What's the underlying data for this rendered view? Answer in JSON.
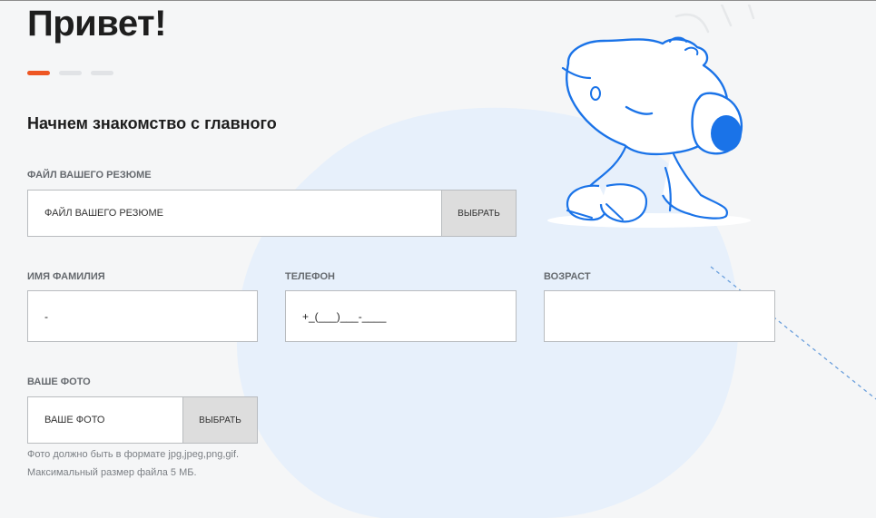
{
  "page": {
    "title": "Привет!",
    "subtitle": "Начнем знакомство с главного",
    "steps": {
      "total": 3,
      "current": 1
    }
  },
  "resume": {
    "label": "ФАЙЛ ВАШЕГО РЕЗЮМЕ",
    "placeholder": "ФАЙЛ ВАШЕГО РЕЗЮМЕ",
    "button": "ВЫБРАТЬ"
  },
  "name": {
    "label": "ИМЯ ФАМИЛИЯ",
    "value": "-"
  },
  "phone": {
    "label": "ТЕЛЕФОН",
    "value": "+_(___)___-____"
  },
  "age": {
    "label": "ВОЗРАСТ",
    "value": ""
  },
  "photo": {
    "label": "ВАШЕ ФОТО",
    "placeholder": "ВАШЕ ФОТО",
    "button": "ВЫБРАТЬ",
    "hint": "Фото должно быть в формате jpg,jpeg,png,gif. Максимальный размер файла 5 МБ."
  },
  "colors": {
    "accent": "#ee5623",
    "mascot": "#1a73e8",
    "blob": "#e6f0fb",
    "background": "#f5f6f7"
  },
  "icons": [
    "mascot-illustration"
  ]
}
